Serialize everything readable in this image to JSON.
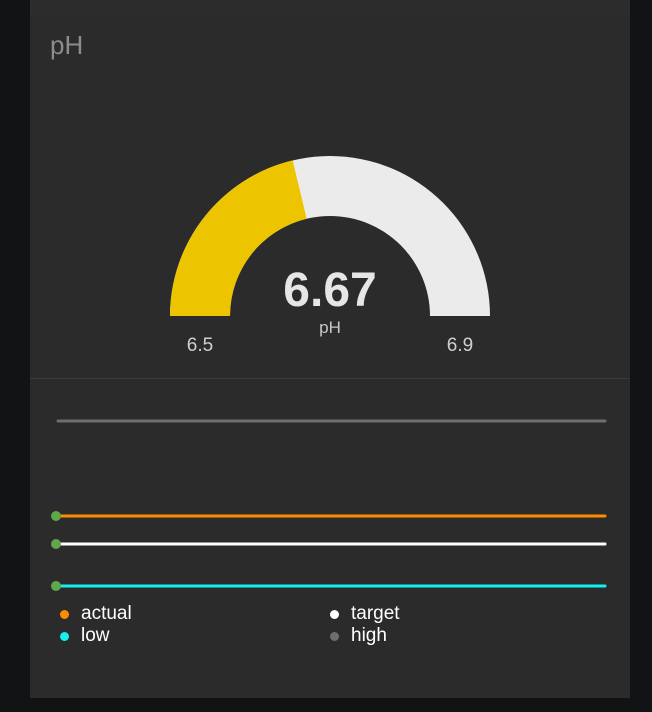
{
  "card": {
    "title": "pH"
  },
  "gauge": {
    "value": "6.67",
    "value_num": 6.67,
    "unit": "pH",
    "min": 6.5,
    "max": 6.9,
    "min_label": "6.5",
    "max_label": "6.9",
    "fill_color": "#ecc500",
    "track_color": "#ecebec"
  },
  "chart_data": {
    "type": "line",
    "series": [
      {
        "name": "actual",
        "color": "#ff8c00"
      },
      {
        "name": "target",
        "color": "#ffffff"
      },
      {
        "name": "low",
        "color": "#16f0ec"
      },
      {
        "name": "high",
        "color": "#6e6e6e"
      }
    ],
    "legend": "bottom"
  },
  "legend": {
    "items": [
      {
        "label": "actual",
        "color": "#ff8c00"
      },
      {
        "label": "target",
        "color": "#ffffff"
      },
      {
        "label": "low",
        "color": "#16f0ec"
      },
      {
        "label": "high",
        "color": "#6e6e6e"
      }
    ]
  }
}
